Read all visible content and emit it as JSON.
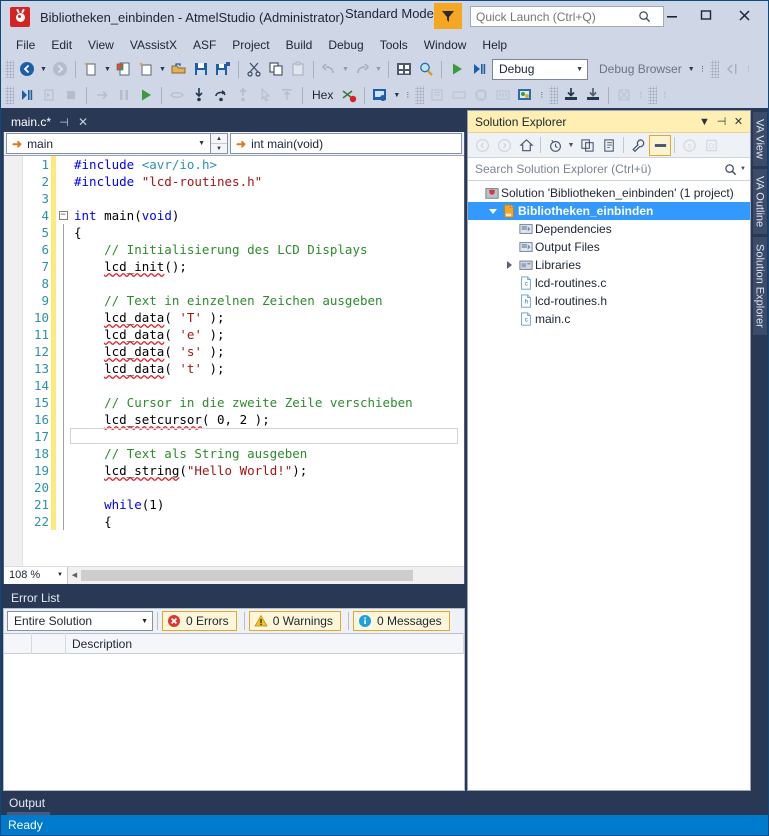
{
  "window": {
    "title": "Bibliotheken_einbinden - AtmelStudio (Administrator)",
    "mode_label": "Standard Mode",
    "minimize": "–",
    "maximize": "❐",
    "close": "✕"
  },
  "quick_launch": {
    "placeholder": "Quick Launch (Ctrl+Q)",
    "value": ""
  },
  "menu": {
    "items": [
      "File",
      "Edit",
      "View",
      "VAssistX",
      "ASF",
      "Project",
      "Build",
      "Debug",
      "Tools",
      "Window",
      "Help"
    ]
  },
  "toolbar1": {
    "debug_config": "Debug",
    "debug_browser": "Debug Browser",
    "hex_label": "Hex"
  },
  "editor": {
    "tab_label": "main.c*",
    "tab_pin": "⊣",
    "tab_close": "✕",
    "nav_scope": "main",
    "nav_member": "int main(void)",
    "zoom": "108 %",
    "lines": [
      {
        "n": "1",
        "fold": "",
        "changed": true,
        "tokens": [
          {
            "t": "#include ",
            "c": "pp"
          },
          {
            "t": "<avr/io.h>",
            "c": "typ"
          }
        ]
      },
      {
        "n": "2",
        "fold": "",
        "changed": true,
        "tokens": [
          {
            "t": "#include ",
            "c": "pp"
          },
          {
            "t": "\"lcd-routines.h\"",
            "c": "str"
          }
        ]
      },
      {
        "n": "3",
        "fold": "",
        "changed": true,
        "tokens": []
      },
      {
        "n": "4",
        "fold": "minus",
        "changed": true,
        "tokens": [
          {
            "t": "int",
            "c": "kw"
          },
          {
            "t": " ",
            "c": "id"
          },
          {
            "t": "main",
            "c": "id"
          },
          {
            "t": "(",
            "c": "id"
          },
          {
            "t": "void",
            "c": "kw"
          },
          {
            "t": ")",
            "c": "id"
          }
        ]
      },
      {
        "n": "5",
        "fold": "line",
        "changed": true,
        "tokens": [
          {
            "t": "{",
            "c": "id"
          }
        ]
      },
      {
        "n": "6",
        "fold": "line",
        "changed": true,
        "tokens": [
          {
            "t": "    // Initialisierung des LCD Displays",
            "c": "cmt"
          }
        ]
      },
      {
        "n": "7",
        "fold": "line",
        "changed": true,
        "tokens": [
          {
            "t": "    ",
            "c": "id"
          },
          {
            "t": "lcd_init",
            "c": "id sq"
          },
          {
            "t": "();",
            "c": "id"
          }
        ]
      },
      {
        "n": "8",
        "fold": "line",
        "changed": true,
        "tokens": []
      },
      {
        "n": "9",
        "fold": "line",
        "changed": true,
        "tokens": [
          {
            "t": "    // Text in einzelnen Zeichen ausgeben",
            "c": "cmt"
          }
        ]
      },
      {
        "n": "10",
        "fold": "line",
        "changed": true,
        "tokens": [
          {
            "t": "    ",
            "c": "id"
          },
          {
            "t": "lcd_data",
            "c": "id sq"
          },
          {
            "t": "( ",
            "c": "id"
          },
          {
            "t": "'T'",
            "c": "str"
          },
          {
            "t": " );",
            "c": "id"
          }
        ]
      },
      {
        "n": "11",
        "fold": "line",
        "changed": true,
        "tokens": [
          {
            "t": "    ",
            "c": "id"
          },
          {
            "t": "lcd_data",
            "c": "id sq"
          },
          {
            "t": "( ",
            "c": "id"
          },
          {
            "t": "'e'",
            "c": "str"
          },
          {
            "t": " );",
            "c": "id"
          }
        ]
      },
      {
        "n": "12",
        "fold": "line",
        "changed": true,
        "tokens": [
          {
            "t": "    ",
            "c": "id"
          },
          {
            "t": "lcd_data",
            "c": "id sq"
          },
          {
            "t": "( ",
            "c": "id"
          },
          {
            "t": "'s'",
            "c": "str"
          },
          {
            "t": " );",
            "c": "id"
          }
        ]
      },
      {
        "n": "13",
        "fold": "line",
        "changed": true,
        "tokens": [
          {
            "t": "    ",
            "c": "id"
          },
          {
            "t": "lcd_data",
            "c": "id sq"
          },
          {
            "t": "( ",
            "c": "id"
          },
          {
            "t": "'t'",
            "c": "str"
          },
          {
            "t": " );",
            "c": "id"
          }
        ]
      },
      {
        "n": "14",
        "fold": "line",
        "changed": true,
        "tokens": []
      },
      {
        "n": "15",
        "fold": "line",
        "changed": true,
        "tokens": [
          {
            "t": "    // Cursor in die zweite Zeile verschieben",
            "c": "cmt"
          }
        ]
      },
      {
        "n": "16",
        "fold": "line",
        "changed": true,
        "tokens": [
          {
            "t": "    ",
            "c": "id"
          },
          {
            "t": "lcd_setcursor",
            "c": "id sq"
          },
          {
            "t": "( ",
            "c": "id"
          },
          {
            "t": "0",
            "c": "num"
          },
          {
            "t": ", ",
            "c": "id"
          },
          {
            "t": "2",
            "c": "num"
          },
          {
            "t": " );",
            "c": "id"
          }
        ]
      },
      {
        "n": "17",
        "fold": "line",
        "changed": true,
        "current": true,
        "tokens": []
      },
      {
        "n": "18",
        "fold": "line",
        "changed": true,
        "tokens": [
          {
            "t": "    // Text als String ausgeben",
            "c": "cmt"
          }
        ]
      },
      {
        "n": "19",
        "fold": "line",
        "changed": true,
        "tokens": [
          {
            "t": "    ",
            "c": "id"
          },
          {
            "t": "lcd_string",
            "c": "id sq"
          },
          {
            "t": "(",
            "c": "id"
          },
          {
            "t": "\"Hello World!\"",
            "c": "str"
          },
          {
            "t": ");",
            "c": "id"
          }
        ]
      },
      {
        "n": "20",
        "fold": "line",
        "changed": true,
        "tokens": []
      },
      {
        "n": "21",
        "fold": "line",
        "changed": true,
        "tokens": [
          {
            "t": "    ",
            "c": "id"
          },
          {
            "t": "while",
            "c": "kw"
          },
          {
            "t": "(",
            "c": "id"
          },
          {
            "t": "1",
            "c": "num"
          },
          {
            "t": ")",
            "c": "id"
          }
        ]
      },
      {
        "n": "22",
        "fold": "line",
        "changed": true,
        "tokens": [
          {
            "t": "    {",
            "c": "id"
          }
        ]
      }
    ]
  },
  "error_list": {
    "title": "Error List",
    "scope": "Entire Solution",
    "errors": "0 Errors",
    "warnings": "0 Warnings",
    "messages": "0 Messages",
    "columns": [
      "",
      "",
      "Description"
    ]
  },
  "solution_explorer": {
    "title": "Solution Explorer",
    "search_placeholder": "Search Solution Explorer (Ctrl+ü)",
    "tree": [
      {
        "label": "Solution 'Bibliotheken_einbinden' (1 project)",
        "indent": 0,
        "icon": "solution-icon",
        "twisty": "none",
        "selected": false
      },
      {
        "label": "Bibliotheken_einbinden",
        "indent": 1,
        "icon": "project-icon",
        "twisty": "down",
        "selected": true
      },
      {
        "label": "Dependencies",
        "indent": 2,
        "icon": "references-icon",
        "twisty": "none",
        "selected": false
      },
      {
        "label": "Output Files",
        "indent": 2,
        "icon": "references-icon",
        "twisty": "none",
        "selected": false
      },
      {
        "label": "Libraries",
        "indent": 2,
        "icon": "folder-icon",
        "twisty": "right",
        "selected": false
      },
      {
        "label": "lcd-routines.c",
        "indent": 2,
        "icon": "c-file-icon",
        "twisty": "none",
        "selected": false
      },
      {
        "label": "lcd-routines.h",
        "indent": 2,
        "icon": "h-file-icon",
        "twisty": "none",
        "selected": false
      },
      {
        "label": "main.c",
        "indent": 2,
        "icon": "c-file-icon",
        "twisty": "none",
        "selected": false
      }
    ]
  },
  "vertical_tabs": [
    "VA View",
    "VA Outline",
    "Solution Explorer"
  ],
  "output_dock": {
    "label": "Output"
  },
  "status_bar": {
    "text": "Ready"
  },
  "colors": {
    "chrome": "#cfd6e5",
    "frame": "#293955",
    "status": "#007acc",
    "selection": "#3399ff",
    "active_panel_header": "#ffefb2"
  }
}
